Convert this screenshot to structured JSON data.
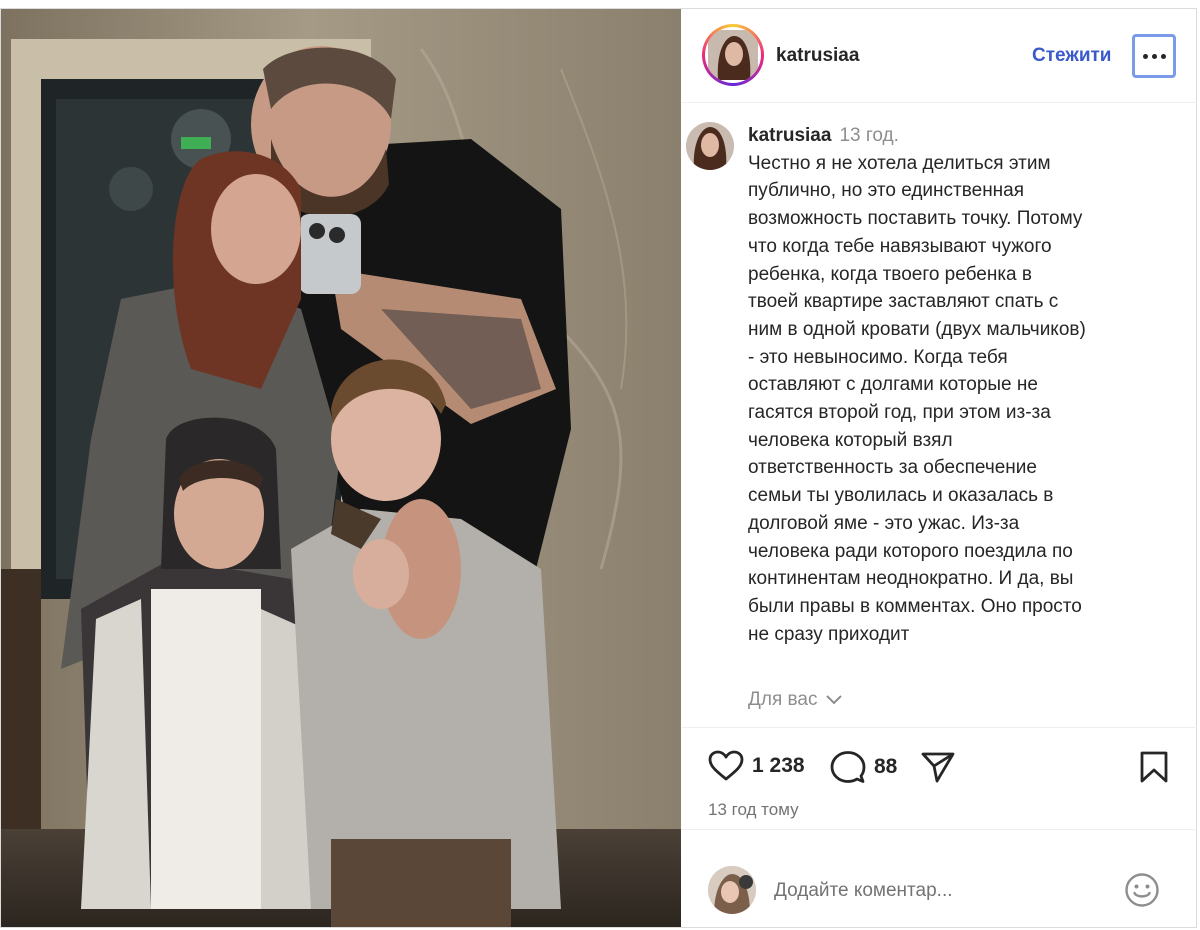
{
  "post": {
    "username": "katrusiaa",
    "follow_label": "Стежити",
    "more_icon": "more-horizontal-icon",
    "accent_color": "#3b5ac9",
    "caption": {
      "username": "katrusiaa",
      "time": "13 год.",
      "text": "Честно я не хотела делиться этим\nпублично, но это единственная\nвозможность поставить точку. Потому\nчто когда тебе навязывают чужого\nребенка, когда твоего ребенка в\nтвоей квартире заставляют спать с\nним в одной кровати (двух мальчиков)\n- это невыносимо. Когда тебя\nоставляют с долгами которые не\nгасятся второй год, при этом из-за\nчеловека который взял\nответственность за обеспечение\nсемьи ты уволилась и оказалась в\nдолговой яме - это ужас. Из-за\nчеловека ради которого поездила по\nконтинентам неоднократно. И да, вы\nбыли правы в комментах. Оно просто\nне сразу приходит"
    },
    "for_you_label": "Для вас",
    "likes": "1 238",
    "comments": "88",
    "time_ago": "13 год тому",
    "comment_placeholder": "Додайте коментар...",
    "icons": [
      "heart-icon",
      "comment-icon",
      "share-icon",
      "bookmark-icon",
      "emoji-icon",
      "chevron-down-icon"
    ]
  }
}
